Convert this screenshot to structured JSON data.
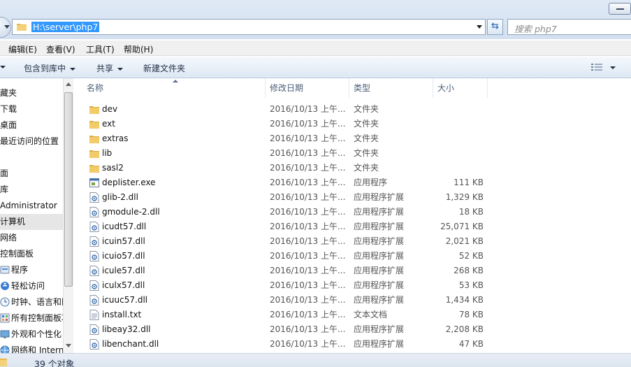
{
  "address": {
    "path": "H:\\server\\php7",
    "search_placeholder": "搜索 php7"
  },
  "menu": [
    "编辑(E)",
    "查看(V)",
    "工具(T)",
    "帮助(H)"
  ],
  "commands": {
    "include_library": "包含到库中",
    "share": "共享",
    "new_folder": "新建文件夹"
  },
  "nav": [
    {
      "label": "藏夹",
      "icon": "star-icon"
    },
    {
      "label": "下载",
      "icon": "download-icon"
    },
    {
      "label": "桌面",
      "icon": "desktop-icon"
    },
    {
      "label": "最近访问的位置",
      "icon": "recent-icon"
    },
    {
      "label": "",
      "icon": ""
    },
    {
      "label": "面",
      "icon": "desktop-icon"
    },
    {
      "label": "库",
      "icon": "library-icon"
    },
    {
      "label": "Administrator",
      "icon": "user-icon"
    },
    {
      "label": "计算机",
      "icon": "computer-icon"
    },
    {
      "label": "网络",
      "icon": "network-icon"
    },
    {
      "label": "控制面板",
      "icon": "control-panel-icon"
    },
    {
      "label": "程序",
      "icon": "programs-icon"
    },
    {
      "label": "轻松访问",
      "icon": "ease-of-access-icon"
    },
    {
      "label": "时钟、语言和区",
      "icon": "clock-icon"
    },
    {
      "label": "所有控制面板项",
      "icon": "control-panel-icon"
    },
    {
      "label": "外观和个性化",
      "icon": "appearance-icon"
    },
    {
      "label": "网络和 Interne",
      "icon": "network-icon"
    }
  ],
  "columns": {
    "name": "名称",
    "date": "修改日期",
    "type": "类型",
    "size": "大小"
  },
  "files": [
    {
      "name": "dev",
      "date": "2016/10/13 上午...",
      "type": "文件夹",
      "size": "",
      "icon": "folder-icon"
    },
    {
      "name": "ext",
      "date": "2016/10/13 上午...",
      "type": "文件夹",
      "size": "",
      "icon": "folder-icon"
    },
    {
      "name": "extras",
      "date": "2016/10/13 上午...",
      "type": "文件夹",
      "size": "",
      "icon": "folder-icon"
    },
    {
      "name": "lib",
      "date": "2016/10/13 上午...",
      "type": "文件夹",
      "size": "",
      "icon": "folder-icon"
    },
    {
      "name": "sasl2",
      "date": "2016/10/13 上午...",
      "type": "文件夹",
      "size": "",
      "icon": "folder-icon"
    },
    {
      "name": "deplister.exe",
      "date": "2016/10/13 上午...",
      "type": "应用程序",
      "size": "111 KB",
      "icon": "exe-icon"
    },
    {
      "name": "glib-2.dll",
      "date": "2016/10/13 上午...",
      "type": "应用程序扩展",
      "size": "1,329 KB",
      "icon": "dll-icon"
    },
    {
      "name": "gmodule-2.dll",
      "date": "2016/10/13 上午...",
      "type": "应用程序扩展",
      "size": "18 KB",
      "icon": "dll-icon"
    },
    {
      "name": "icudt57.dll",
      "date": "2016/10/13 上午...",
      "type": "应用程序扩展",
      "size": "25,071 KB",
      "icon": "dll-icon"
    },
    {
      "name": "icuin57.dll",
      "date": "2016/10/13 上午...",
      "type": "应用程序扩展",
      "size": "2,021 KB",
      "icon": "dll-icon"
    },
    {
      "name": "icuio57.dll",
      "date": "2016/10/13 上午...",
      "type": "应用程序扩展",
      "size": "52 KB",
      "icon": "dll-icon"
    },
    {
      "name": "icule57.dll",
      "date": "2016/10/13 上午...",
      "type": "应用程序扩展",
      "size": "268 KB",
      "icon": "dll-icon"
    },
    {
      "name": "iculx57.dll",
      "date": "2016/10/13 上午...",
      "type": "应用程序扩展",
      "size": "53 KB",
      "icon": "dll-icon"
    },
    {
      "name": "icuuc57.dll",
      "date": "2016/10/13 上午...",
      "type": "应用程序扩展",
      "size": "1,434 KB",
      "icon": "dll-icon"
    },
    {
      "name": "install.txt",
      "date": "2016/10/13 上午...",
      "type": "文本文档",
      "size": "78 KB",
      "icon": "txt-icon"
    },
    {
      "name": "libeay32.dll",
      "date": "2016/10/13 上午...",
      "type": "应用程序扩展",
      "size": "2,208 KB",
      "icon": "dll-icon"
    },
    {
      "name": "libenchant.dll",
      "date": "2016/10/13 上午...",
      "type": "应用程序扩展",
      "size": "47 KB",
      "icon": "dll-icon"
    }
  ],
  "status": {
    "count": "39 个对象"
  }
}
